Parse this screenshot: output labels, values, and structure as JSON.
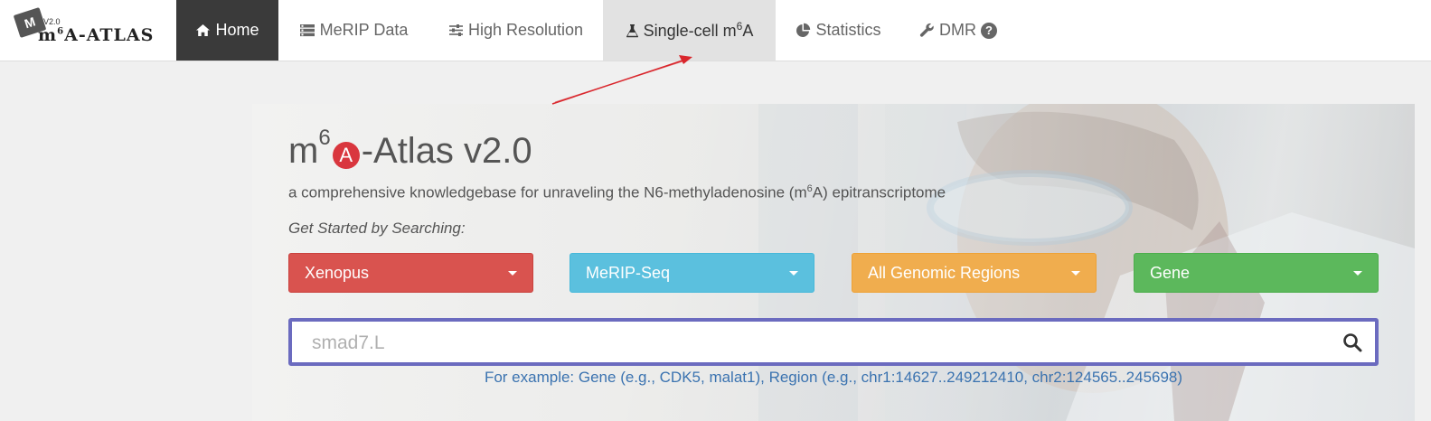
{
  "brand": {
    "logo_mark": "M",
    "version": "V2.0",
    "name_prefix": "m",
    "name_sup": "6",
    "name_suffix": "A-ATLAS"
  },
  "nav": {
    "home": "Home",
    "merip": "MeRIP Data",
    "high_res": "High Resolution",
    "single_cell_prefix": "Single-cell m",
    "single_cell_sup": "6",
    "single_cell_suffix": "A",
    "statistics": "Statistics",
    "dmr": "DMR",
    "help_glyph": "?"
  },
  "hero": {
    "title_prefix": "m",
    "title_sup": "6",
    "title_badge": "A",
    "title_suffix": "-Atlas v2.0",
    "subtitle_prefix": "a comprehensive knowledgebase for unraveling the N6-methyladenosine (m",
    "subtitle_sup": "6",
    "subtitle_suffix": "A) epitranscriptome",
    "prompt": "Get Started by Searching:"
  },
  "filters": {
    "species": "Xenopus",
    "technique": "MeRIP-Seq",
    "region": "All Genomic Regions",
    "query_type": "Gene"
  },
  "search": {
    "placeholder": "smad7.L",
    "value": ""
  },
  "example": "For example: Gene (e.g., CDK5, malat1), Region (e.g., chr1:14627..249212410, chr2:124565..245698)",
  "colors": {
    "species": "#d9534f",
    "technique": "#5bc0de",
    "region": "#f0ad4e",
    "type": "#5cb85c",
    "search_border": "#6b6bbf",
    "annotation_arrow": "#d9262c"
  },
  "icons": {
    "home": "home-icon",
    "merip": "list-icon",
    "high_res": "sliders-icon",
    "single_cell": "flask-icon",
    "statistics": "pie-chart-icon",
    "dmr": "wrench-icon",
    "help": "question-circle-icon",
    "search": "search-icon"
  }
}
